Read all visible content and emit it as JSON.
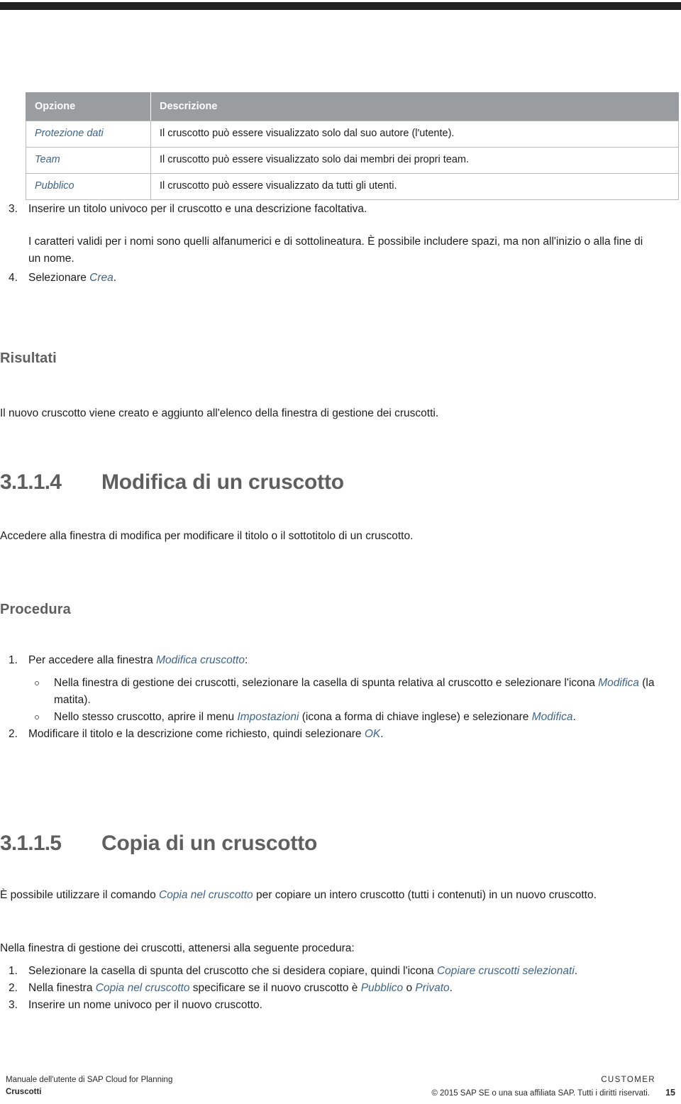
{
  "document": {
    "language": "it",
    "accent_color": "#3f6487",
    "heading_color": "#5f5f5f",
    "table_header_bg": "#9a9da0",
    "top_band_color": "#1f2123"
  },
  "table": {
    "headers": [
      "Opzione",
      "Descrizione"
    ],
    "rows": [
      {
        "option": "Protezione dati",
        "description": "Il cruscotto può essere visualizzato solo dal suo autore (l'utente)."
      },
      {
        "option": "Team",
        "description": "Il cruscotto può essere visualizzato solo dai membri dei propri team."
      },
      {
        "option": "Pubblico",
        "description": "Il cruscotto può essere visualizzato da tutti gli utenti."
      }
    ]
  },
  "steps_create": {
    "item3_marker": "3.",
    "item3_text": "Inserire un titolo univoco per il cruscotto e una descrizione facoltativa.",
    "item3_note_a": "I caratteri validi per i nomi sono quelli alfanumerici e di sottolineatura. È possibile includere spazi, ma non all'inizio o alla fine di un nome.",
    "item4_marker": "4.",
    "item4_prefix": "Selezionare ",
    "item4_link": "Crea",
    "item4_suffix": "."
  },
  "results": {
    "heading": "Risultati",
    "text": "Il nuovo cruscotto viene creato e aggiunto all'elenco della finestra di gestione dei cruscotti."
  },
  "section_edit": {
    "number": "3.1.1.4",
    "title": "Modifica di un cruscotto",
    "intro": "Accedere alla finestra di modifica per modificare il titolo o il sottotitolo di un cruscotto.",
    "procedure_heading": "Procedura",
    "step1_marker": "1.",
    "step1_prefix": "Per accedere alla finestra ",
    "step1_link": "Modifica cruscotto",
    "step1_suffix": ":",
    "bullet1_part1": "Nella finestra di gestione dei cruscotti, selezionare la casella di spunta relativa al cruscotto e selezionare l'icona ",
    "bullet1_link": "Modifica",
    "bullet1_part2": " (la matita).",
    "bullet2_part1": "Nello stesso cruscotto, aprire il menu ",
    "bullet2_link1": "Impostazioni",
    "bullet2_part2": " (icona a forma di chiave inglese) e selezionare ",
    "bullet2_link2": "Modifica",
    "bullet2_part3": ".",
    "step2_marker": "2.",
    "step2_prefix": "Modificare il titolo e la descrizione come richiesto, quindi selezionare ",
    "step2_link": "OK",
    "step2_suffix": "."
  },
  "section_copy": {
    "number": "3.1.1.5",
    "title": "Copia di un cruscotto",
    "intro_part1": "È possibile utilizzare il comando ",
    "intro_link": "Copia nel cruscotto",
    "intro_part2": " per copiare un intero cruscotto (tutti i contenuti) in un nuovo cruscotto.",
    "lead": "Nella finestra di gestione dei cruscotti, attenersi alla seguente procedura:",
    "step1_marker": "1.",
    "step1_part1": "Selezionare la casella di spunta del cruscotto che si desidera copiare, quindi l'icona ",
    "step1_link": "Copiare cruscotti selezionati",
    "step1_part2": ".",
    "step2_marker": "2.",
    "step2_part1": "Nella finestra ",
    "step2_link1": "Copia nel cruscotto",
    "step2_part2": " specificare se il nuovo cruscotto è ",
    "step2_link2": "Pubblico",
    "step2_part3": " o ",
    "step2_link3": "Privato",
    "step2_part4": ".",
    "step3_marker": "3.",
    "step3_text": "Inserire un nome univoco per il nuovo cruscotto."
  },
  "footer": {
    "left_line1": "Manuale dell'utente di SAP Cloud for Planning",
    "left_line2": "Cruscotti",
    "right_line1": "CUSTOMER",
    "right_line2": "© 2015 SAP SE o una sua affiliata SAP. Tutti i diritti riservati.",
    "page_number": "15"
  }
}
